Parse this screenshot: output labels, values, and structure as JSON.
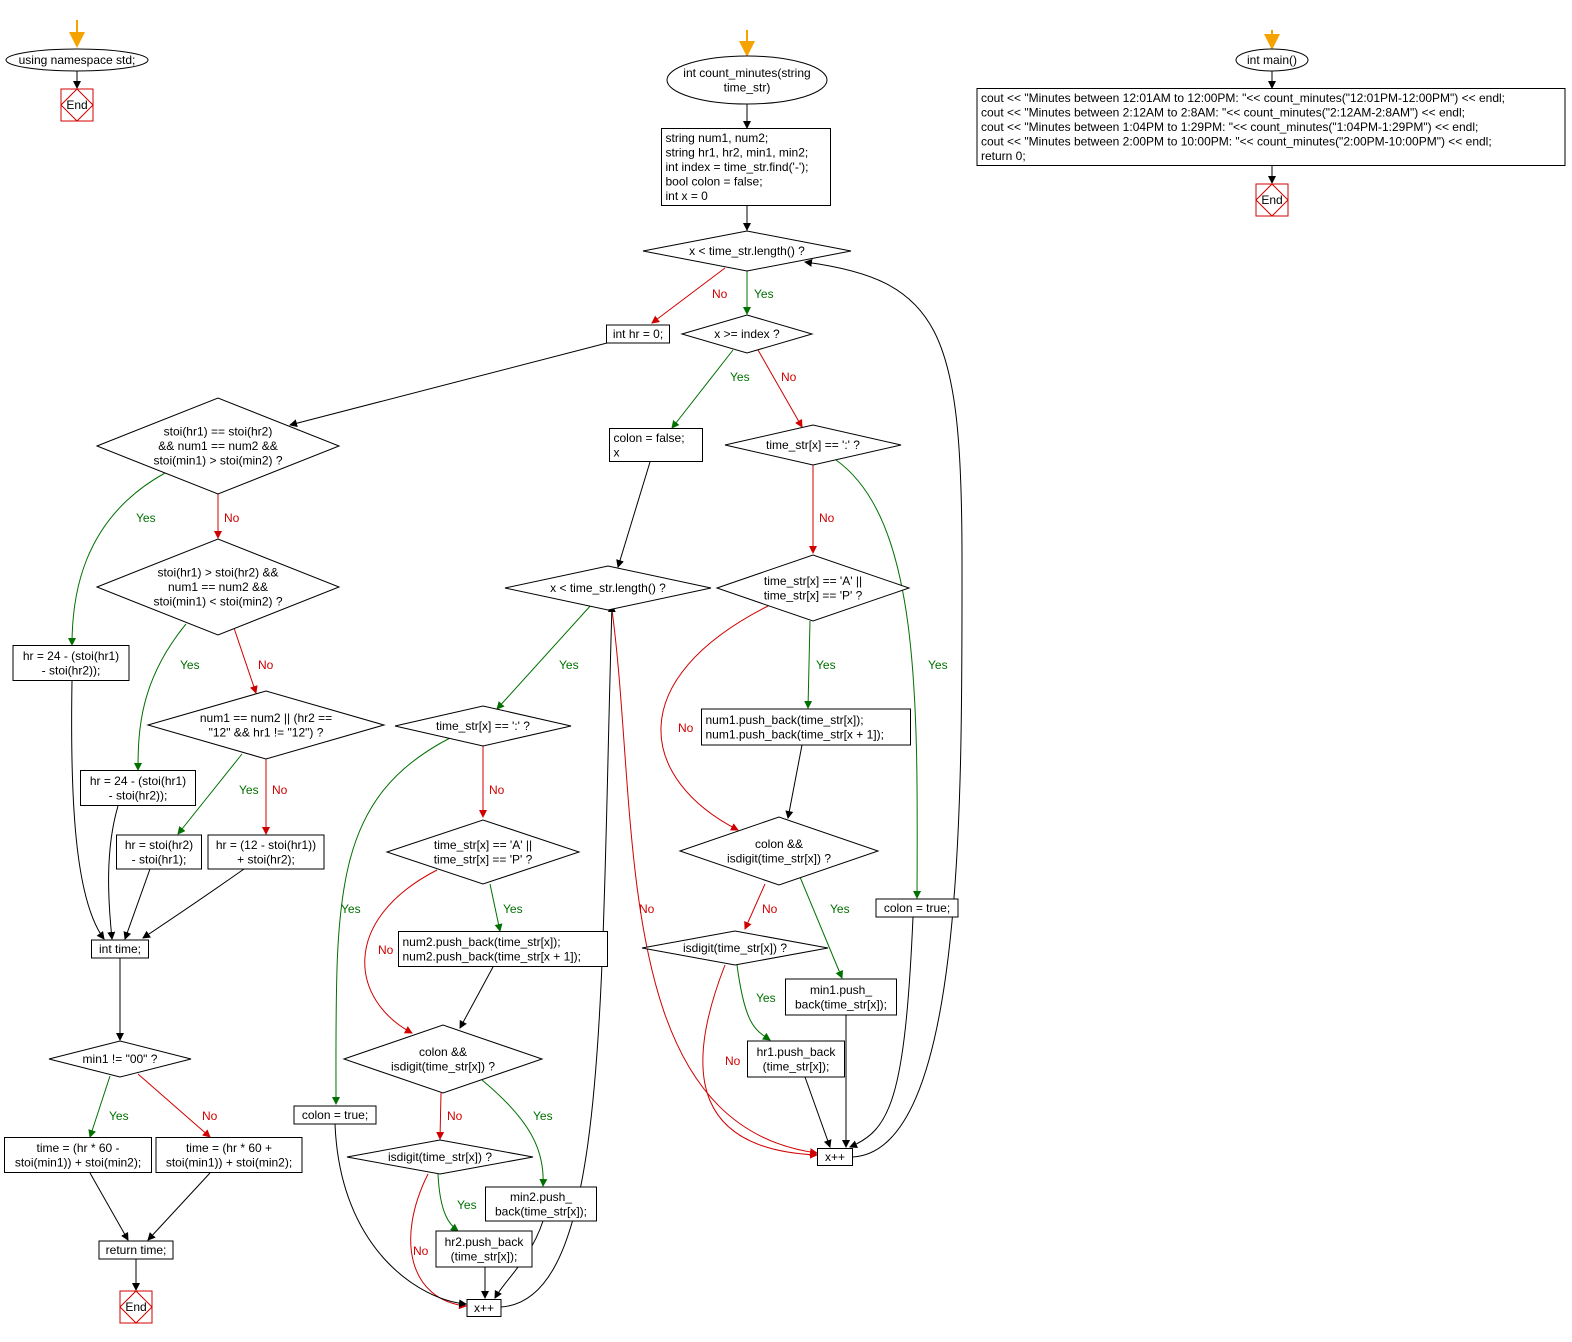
{
  "edge_labels": {
    "yes": "Yes",
    "no": "No"
  },
  "colors": {
    "start_arrow": "#f5a300",
    "yes": "#007000",
    "no": "#d00000",
    "plain": "#000000",
    "end_border": "#d00000"
  },
  "nodes": {
    "ns": {
      "shape": "ellipse",
      "lines": [
        "using namespace std;"
      ]
    },
    "end1": {
      "shape": "end",
      "lines": [
        "End"
      ]
    },
    "fn": {
      "shape": "ellipse",
      "lines": [
        "int count_minutes(string",
        "time_str)"
      ]
    },
    "init": {
      "shape": "rect",
      "lines": [
        "string num1, num2;",
        "string hr1, hr2, min1, min2;",
        "int index = time_str.find('-');",
        "bool colon = false;",
        "int x = 0"
      ]
    },
    "d1": {
      "shape": "diamond",
      "lines": [
        "x < time_str.length() ?"
      ]
    },
    "hr0": {
      "shape": "rect",
      "lines": [
        "int hr = 0;"
      ]
    },
    "d2": {
      "shape": "diamond",
      "lines": [
        "x >= index ?"
      ]
    },
    "colonF": {
      "shape": "rect",
      "lines": [
        "colon = false;",
        "x"
      ]
    },
    "d3": {
      "shape": "diamond",
      "lines": [
        "time_str[x] == ':' ?"
      ]
    },
    "d4": {
      "shape": "diamond",
      "lines": [
        "x < time_str.length() ?"
      ]
    },
    "d5": {
      "shape": "diamond",
      "lines": [
        "time_str[x] == 'A' ||",
        "time_str[x] == 'P' ?"
      ]
    },
    "push1": {
      "shape": "rect",
      "lines": [
        "num1.push_back(time_str[x]);",
        "num1.push_back(time_str[x + 1]);"
      ]
    },
    "colonT1": {
      "shape": "rect",
      "lines": [
        "colon = true;"
      ]
    },
    "d6": {
      "shape": "diamond",
      "lines": [
        "colon &&",
        "isdigit(time_str[x]) ?"
      ]
    },
    "d7": {
      "shape": "diamond",
      "lines": [
        "isdigit(time_str[x]) ?"
      ]
    },
    "min1": {
      "shape": "rect",
      "lines": [
        "min1.push_",
        "back(time_str[x]);"
      ]
    },
    "hr1": {
      "shape": "rect",
      "lines": [
        "hr1.push_back",
        "(time_str[x]);"
      ]
    },
    "xpp1": {
      "shape": "rect",
      "lines": [
        "x++"
      ]
    },
    "d8": {
      "shape": "diamond",
      "lines": [
        "time_str[x] == ':' ?"
      ]
    },
    "colonT2": {
      "shape": "rect",
      "lines": [
        "colon = true;"
      ]
    },
    "d9": {
      "shape": "diamond",
      "lines": [
        "time_str[x] == 'A' ||",
        "time_str[x] == 'P' ?"
      ]
    },
    "push2": {
      "shape": "rect",
      "lines": [
        "num2.push_back(time_str[x]);",
        "num2.push_back(time_str[x + 1]);"
      ]
    },
    "d10": {
      "shape": "diamond",
      "lines": [
        "colon &&",
        "isdigit(time_str[x]) ?"
      ]
    },
    "d11": {
      "shape": "diamond",
      "lines": [
        "isdigit(time_str[x]) ?"
      ]
    },
    "min2": {
      "shape": "rect",
      "lines": [
        "min2.push_",
        "back(time_str[x]);"
      ]
    },
    "hr2": {
      "shape": "rect",
      "lines": [
        "hr2.push_back",
        "(time_str[x]);"
      ]
    },
    "xpp2": {
      "shape": "rect",
      "lines": [
        "x++"
      ]
    },
    "d12": {
      "shape": "diamond",
      "lines": [
        "stoi(hr1) == stoi(hr2)",
        "&& num1 == num2 &&",
        "stoi(min1) > stoi(min2) ?"
      ]
    },
    "d13": {
      "shape": "diamond",
      "lines": [
        "stoi(hr1) > stoi(hr2) &&",
        "num1 == num2 &&",
        "stoi(min1) < stoi(min2) ?"
      ]
    },
    "d14": {
      "shape": "diamond",
      "lines": [
        "num1 == num2 || (hr2 ==",
        "\"12\" && hr1 != \"12\") ?"
      ]
    },
    "hrA": {
      "shape": "rect",
      "lines": [
        "hr = 24 - (stoi(hr1)",
        "- stoi(hr2));"
      ]
    },
    "hrB": {
      "shape": "rect",
      "lines": [
        "hr = 24 - (stoi(hr1)",
        "- stoi(hr2));"
      ]
    },
    "hrC": {
      "shape": "rect",
      "lines": [
        "hr = stoi(hr2)",
        "- stoi(hr1);"
      ]
    },
    "hrD": {
      "shape": "rect",
      "lines": [
        "hr = (12 - stoi(hr1))",
        "+ stoi(hr2);"
      ]
    },
    "time": {
      "shape": "rect",
      "lines": [
        "int time;"
      ]
    },
    "d15": {
      "shape": "diamond",
      "lines": [
        "min1 != \"00\" ?"
      ]
    },
    "tA": {
      "shape": "rect",
      "lines": [
        "time = (hr * 60 -",
        "stoi(min1)) + stoi(min2);"
      ]
    },
    "tB": {
      "shape": "rect",
      "lines": [
        "time = (hr * 60 +",
        "stoi(min1)) + stoi(min2);"
      ]
    },
    "ret": {
      "shape": "rect",
      "lines": [
        "return time;"
      ]
    },
    "end2": {
      "shape": "end",
      "lines": [
        "End"
      ]
    },
    "main": {
      "shape": "ellipse",
      "lines": [
        "int main()"
      ]
    },
    "mainBody": {
      "shape": "rect",
      "lines": [
        "cout << \"Minutes between 12:01AM to 12:00PM: \"<< count_minutes(\"12:01PM-12:00PM\") << endl;",
        "cout << \"Minutes between 2:12AM to 2:8AM: \"<< count_minutes(\"2:12AM-2:8AM\") << endl;",
        "cout << \"Minutes between 1:04PM to 1:29PM: \"<< count_minutes(\"1:04PM-1:29PM\") << endl;",
        "cout << \"Minutes between 2:00PM to 10:00PM: \"<< count_minutes(\"2:00PM-10:00PM\") << endl;",
        "return 0;"
      ]
    },
    "end3": {
      "shape": "end",
      "lines": [
        "End"
      ]
    }
  }
}
